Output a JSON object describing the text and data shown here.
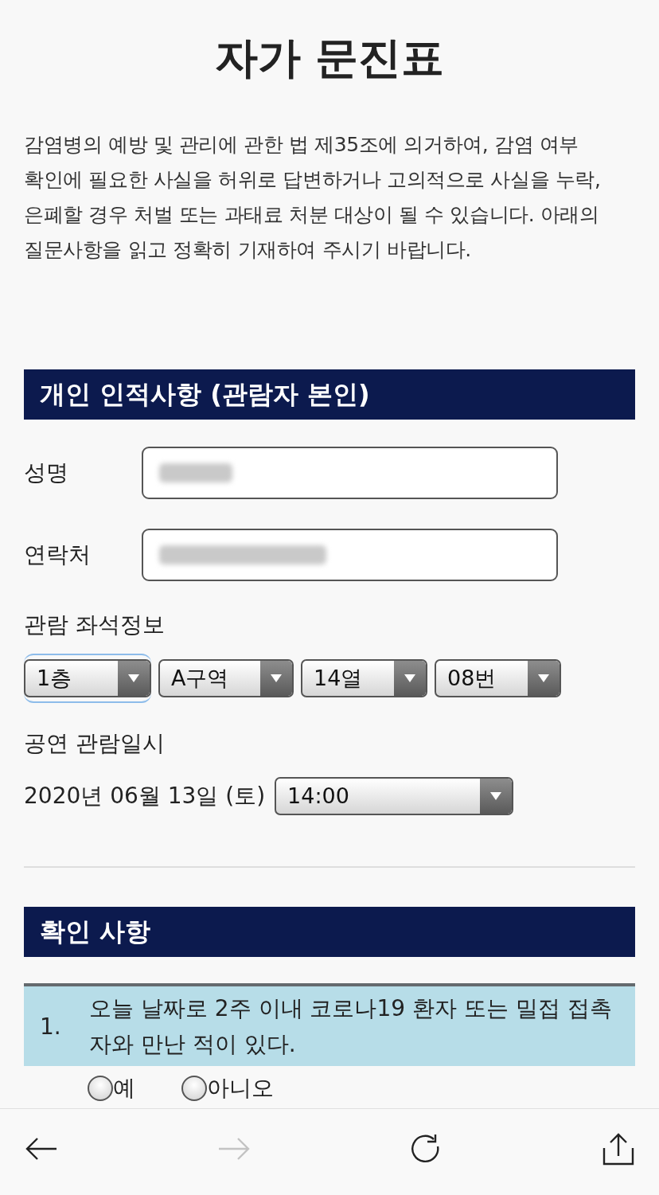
{
  "page": {
    "title": "자가 문진표",
    "notice": "감염병의 예방 및 관리에 관한 법 제35조에 의거하여, 감염 여부 확인에 필요한 사실을 허위로 답변하거나 고의적으로 사실을 누락, 은폐할 경우 처벌 또는 과태료 처분 대상이 될 수 있습니다. 아래의 질문사항을 읽고 정확히 기재하여 주시기 바랍니다."
  },
  "personal": {
    "heading": "개인 인적사항 (관람자 본인)",
    "fields": [
      {
        "label": "성명",
        "value_blurred": true
      },
      {
        "label": "연락처",
        "value_blurred": true
      }
    ],
    "seat": {
      "label": "관람 좌석정보",
      "selects": [
        {
          "value": "1층",
          "focused": true
        },
        {
          "value": "A구역",
          "focused": false
        },
        {
          "value": "14열",
          "focused": false
        },
        {
          "value": "08번",
          "focused": false
        }
      ]
    },
    "datetime": {
      "label": "공연 관람일시",
      "date": "2020년 06월 13일 (토)",
      "time_select": {
        "value": "14:00",
        "focused": false
      }
    }
  },
  "checks": {
    "heading": "확인 사항",
    "questions": [
      {
        "number": "1.",
        "text": "오늘 날짜로 2주 이내 코로나19 환자 또는 밀접 접촉자와 만난 적이 있다.",
        "options": [
          {
            "label": "예",
            "selected": false
          },
          {
            "label": "아니오",
            "selected": false
          }
        ]
      }
    ]
  },
  "toolbar": {
    "buttons": [
      {
        "kind": "back",
        "disabled": false
      },
      {
        "kind": "forward",
        "disabled": true
      },
      {
        "kind": "reload",
        "disabled": false
      },
      {
        "kind": "share",
        "disabled": false
      }
    ]
  }
}
